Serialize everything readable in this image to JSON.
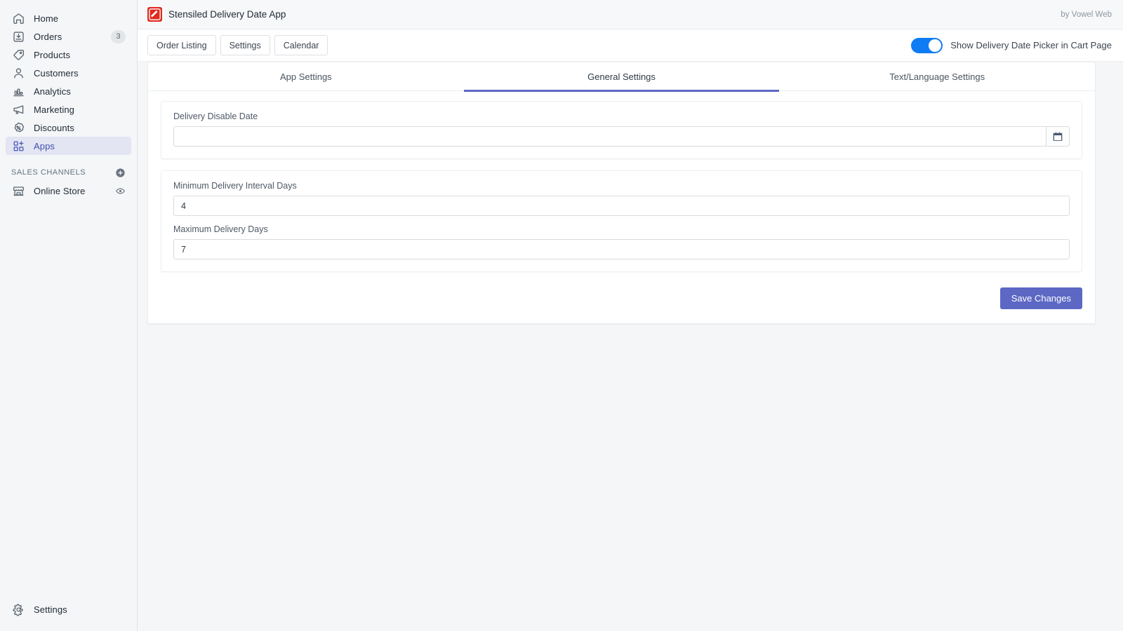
{
  "sidebar": {
    "items": [
      {
        "label": "Home",
        "icon": "home-icon",
        "badge": null,
        "active": false
      },
      {
        "label": "Orders",
        "icon": "orders-icon",
        "badge": "3",
        "active": false
      },
      {
        "label": "Products",
        "icon": "products-icon",
        "badge": null,
        "active": false
      },
      {
        "label": "Customers",
        "icon": "customers-icon",
        "badge": null,
        "active": false
      },
      {
        "label": "Analytics",
        "icon": "analytics-icon",
        "badge": null,
        "active": false
      },
      {
        "label": "Marketing",
        "icon": "marketing-icon",
        "badge": null,
        "active": false
      },
      {
        "label": "Discounts",
        "icon": "discounts-icon",
        "badge": null,
        "active": false
      },
      {
        "label": "Apps",
        "icon": "apps-icon",
        "badge": null,
        "active": true
      }
    ],
    "sales_channels": {
      "title": "SALES CHANNELS",
      "add_icon": "plus-circle-icon",
      "items": [
        {
          "label": "Online Store",
          "icon": "storefront-icon",
          "action_icon": "eye-icon"
        }
      ]
    },
    "settings": {
      "label": "Settings",
      "icon": "gear-icon"
    }
  },
  "header": {
    "logo_icon": "app-logo-slash-icon",
    "title": "Stensiled Delivery Date App",
    "by": "by Vowel Web"
  },
  "toolbar": {
    "buttons": [
      {
        "label": "Order Listing"
      },
      {
        "label": "Settings"
      },
      {
        "label": "Calendar"
      }
    ],
    "toggle": {
      "label": "Show Delivery Date Picker in Cart Page",
      "on": true,
      "color": "#0f7cf4"
    }
  },
  "tabs": [
    {
      "label": "App Settings",
      "active": false
    },
    {
      "label": "General Settings",
      "active": true
    },
    {
      "label": "Text/Language Settings",
      "active": false
    }
  ],
  "form": {
    "delivery_disable_date": {
      "label": "Delivery Disable Date",
      "value": "",
      "placeholder": "",
      "calendar_icon": "calendar-icon"
    },
    "minimum_delivery_interval_days": {
      "label": "Minimum Delivery Interval Days",
      "value": "4",
      "placeholder": ""
    },
    "maximum_delivery_days": {
      "label": "Maximum Delivery Days",
      "value": "7",
      "placeholder": ""
    },
    "save_label": "Save Changes"
  },
  "colors": {
    "accent": "#5c68c4",
    "toggle_on": "#0f7cf4",
    "logo_red": "#e02b20",
    "sidebar_bg": "#f4f6f8",
    "active_nav_bg": "#e4e5f3"
  }
}
